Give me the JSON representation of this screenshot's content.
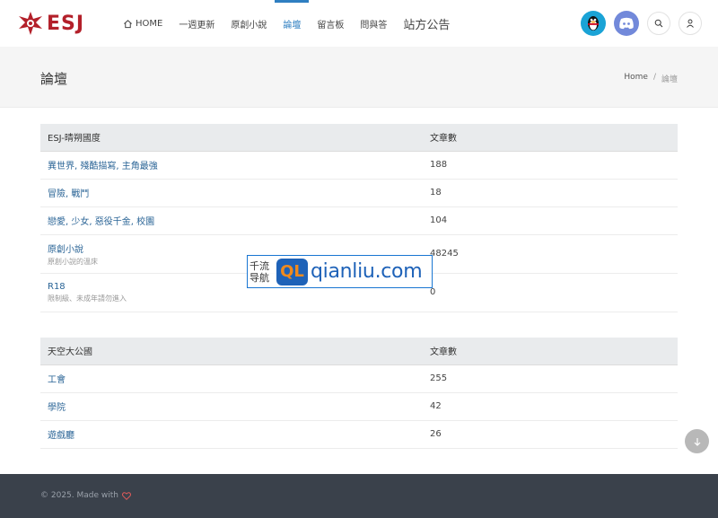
{
  "header": {
    "logo_text": "ESJ",
    "nav": [
      {
        "label": "HOME"
      },
      {
        "label": "一週更新"
      },
      {
        "label": "原創小說"
      },
      {
        "label": "論壇"
      },
      {
        "label": "留言板"
      },
      {
        "label": "問與答"
      },
      {
        "label": "站方公告"
      }
    ]
  },
  "page": {
    "title": "論壇",
    "breadcrumb": {
      "home": "Home",
      "sep": "/",
      "current": "論壇"
    }
  },
  "tables": [
    {
      "header": {
        "name": "ESJ-晴朔國度",
        "count": "文章數"
      },
      "rows": [
        {
          "name": "異世界, 殘酷描寫, 主角最強",
          "desc": "",
          "count": "188"
        },
        {
          "name": "冒險, 戰鬥",
          "desc": "",
          "count": "18"
        },
        {
          "name": "戀愛, 少女, 惡役千金, 校園",
          "desc": "",
          "count": "104"
        },
        {
          "name": "原創小說",
          "desc": "原創小說的溫床",
          "count": "48245"
        },
        {
          "name": "R18",
          "desc": "限制級、未成年請勿進入",
          "count": "0"
        }
      ]
    },
    {
      "header": {
        "name": "天空大公國",
        "count": "文章數"
      },
      "rows": [
        {
          "name": "工會",
          "count": "255"
        },
        {
          "name": "學院",
          "count": "42"
        },
        {
          "name": "遊戲廳",
          "count": "26"
        }
      ]
    }
  ],
  "watermark": {
    "cn_line1": "千流",
    "cn_line2": "导航",
    "badge": "QL",
    "url": "qianliu.com"
  },
  "footer": {
    "text": "© 2025. Made with"
  },
  "colors": {
    "accent": "#2f7fc1",
    "brand": "#b3202a",
    "footer_bg": "#3a414b"
  }
}
